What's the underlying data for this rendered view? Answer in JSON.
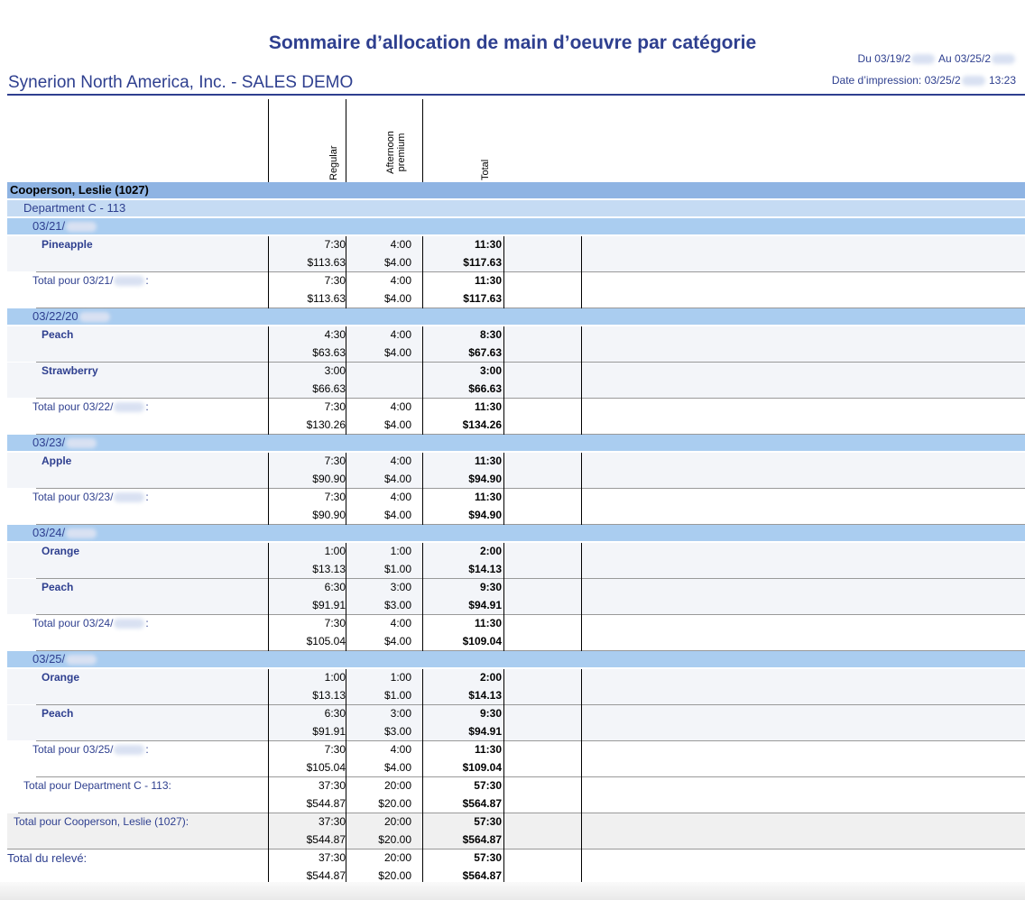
{
  "header": {
    "title": "Sommaire d’allocation de main d’oeuvre par catégorie",
    "period_from": "Du 03/19/2",
    "period_to": "Au 03/25/2",
    "company": "Synerion North America, Inc. - SALES DEMO",
    "print_prefix": "Date d’impression: 03/25/2",
    "print_time": "13:23"
  },
  "columns": [
    "Regular",
    "Afternoon premium",
    "Total"
  ],
  "employee": "Cooperson, Leslie (1027)",
  "department": "Department C - 113",
  "dates": [
    {
      "date": "03/21/",
      "items": [
        {
          "name": "Pineapple",
          "h": [
            "7:30",
            "4:00",
            "11:30"
          ],
          "m": [
            "$113.63",
            "$4.00",
            "$117.63"
          ]
        }
      ],
      "total_label": "Total pour 03/21/",
      "th": [
        "7:30",
        "4:00",
        "11:30"
      ],
      "tm": [
        "$113.63",
        "$4.00",
        "$117.63"
      ]
    },
    {
      "date": "03/22/20",
      "items": [
        {
          "name": "Peach",
          "h": [
            "4:30",
            "4:00",
            "8:30"
          ],
          "m": [
            "$63.63",
            "$4.00",
            "$67.63"
          ]
        },
        {
          "name": "Strawberry",
          "h": [
            "3:00",
            "",
            "3:00"
          ],
          "m": [
            "$66.63",
            "",
            "$66.63"
          ]
        }
      ],
      "total_label": "Total pour 03/22/",
      "th": [
        "7:30",
        "4:00",
        "11:30"
      ],
      "tm": [
        "$130.26",
        "$4.00",
        "$134.26"
      ]
    },
    {
      "date": "03/23/",
      "items": [
        {
          "name": "Apple",
          "h": [
            "7:30",
            "4:00",
            "11:30"
          ],
          "m": [
            "$90.90",
            "$4.00",
            "$94.90"
          ]
        }
      ],
      "total_label": "Total pour 03/23/",
      "th": [
        "7:30",
        "4:00",
        "11:30"
      ],
      "tm": [
        "$90.90",
        "$4.00",
        "$94.90"
      ]
    },
    {
      "date": "03/24/",
      "items": [
        {
          "name": "Orange",
          "h": [
            "1:00",
            "1:00",
            "2:00"
          ],
          "m": [
            "$13.13",
            "$1.00",
            "$14.13"
          ]
        },
        {
          "name": "Peach",
          "h": [
            "6:30",
            "3:00",
            "9:30"
          ],
          "m": [
            "$91.91",
            "$3.00",
            "$94.91"
          ]
        }
      ],
      "total_label": "Total pour 03/24/",
      "th": [
        "7:30",
        "4:00",
        "11:30"
      ],
      "tm": [
        "$105.04",
        "$4.00",
        "$109.04"
      ]
    },
    {
      "date": "03/25/",
      "items": [
        {
          "name": "Orange",
          "h": [
            "1:00",
            "1:00",
            "2:00"
          ],
          "m": [
            "$13.13",
            "$1.00",
            "$14.13"
          ]
        },
        {
          "name": "Peach",
          "h": [
            "6:30",
            "3:00",
            "9:30"
          ],
          "m": [
            "$91.91",
            "$3.00",
            "$94.91"
          ]
        }
      ],
      "total_label": "Total pour 03/25/",
      "th": [
        "7:30",
        "4:00",
        "11:30"
      ],
      "tm": [
        "$105.04",
        "$4.00",
        "$109.04"
      ]
    }
  ],
  "dept_total": {
    "label": "Total pour Department C - 113:",
    "h": [
      "37:30",
      "20:00",
      "57:30"
    ],
    "m": [
      "$544.87",
      "$20.00",
      "$564.87"
    ]
  },
  "emp_total": {
    "label": "Total pour Cooperson, Leslie (1027):",
    "h": [
      "37:30",
      "20:00",
      "57:30"
    ],
    "m": [
      "$544.87",
      "$20.00",
      "$564.87"
    ]
  },
  "report_total": {
    "label": "Total du relevé:",
    "h": [
      "37:30",
      "20:00",
      "57:30"
    ],
    "m": [
      "$544.87",
      "$20.00",
      "$564.87"
    ]
  },
  "colors": {
    "title": "#2e3f8f",
    "employee_band": "#8fb4e3",
    "department_band": "#c5dbf3",
    "date_band": "#aacdf0",
    "item_band": "#f3f5f9",
    "grand_band": "#f0f0f0"
  }
}
